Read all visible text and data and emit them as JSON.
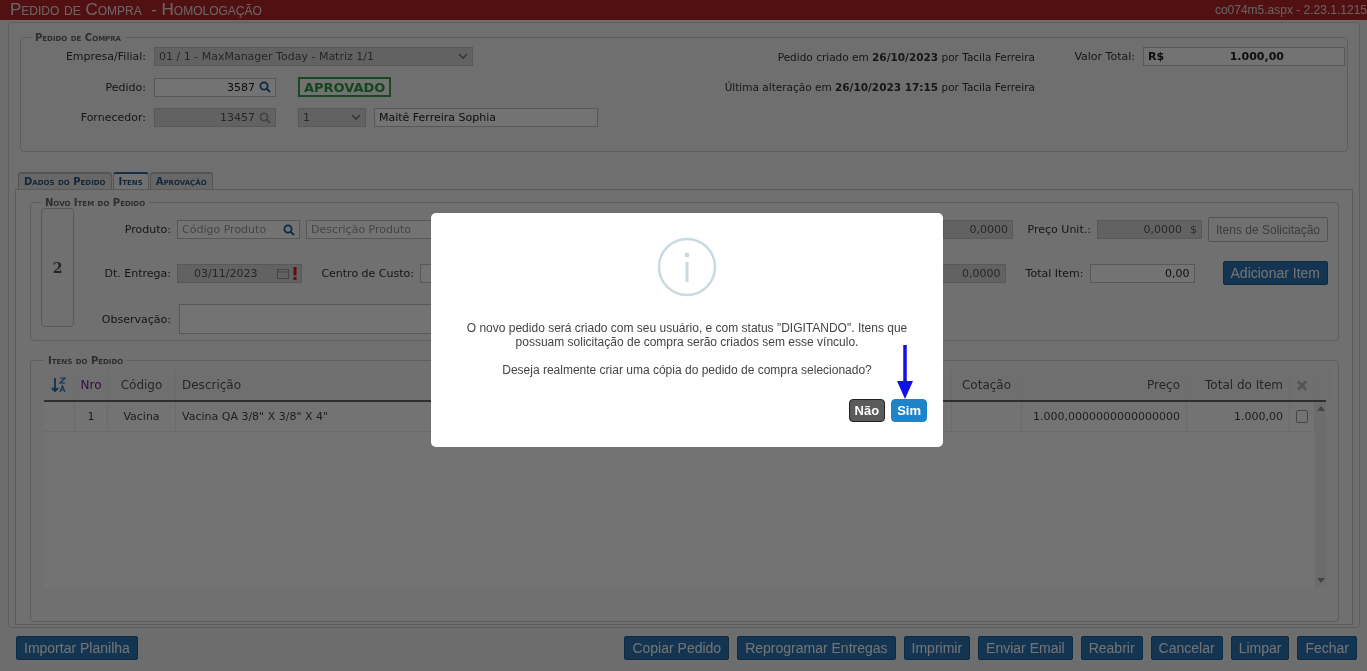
{
  "header": {
    "title": "Pedido de Compra",
    "subtitle": "- Homologação",
    "version": "co074m5.aspx - 2.23.1.1215"
  },
  "order": {
    "legend": "Pedido de Compra",
    "company": {
      "label": "Empresa/Filial:",
      "value": "01 / 1 - MaxManager Today - Matriz 1/1"
    },
    "order_number": {
      "label": "Pedido:",
      "value": "3587"
    },
    "status": "APROVADO",
    "supplier": {
      "label": "Fornecedor:",
      "code": "13457",
      "option": "1",
      "name": "Maitê Ferreira Sophia"
    },
    "created": "Pedido criado em **26/10/2023** por Tacila Ferreira",
    "modified": "Última alteração em **26/10/2023 17:15** por Tacila Ferreira",
    "total": {
      "label": "Valor Total:",
      "currency": "R$",
      "value": "1.000,00"
    }
  },
  "tabs": [
    {
      "label": "Dados do Pedido",
      "selected": false
    },
    {
      "label": "Itens",
      "selected": true
    },
    {
      "label": "Aprovação",
      "selected": false
    }
  ],
  "new_item": {
    "legend": "Novo Item do Pedido",
    "sequence": "2",
    "product": {
      "label": "Produto:",
      "code_placeholder": "Código Produto",
      "description_placeholder": "Descrição Produto"
    },
    "delivery": {
      "label": "Dt. Entrega:",
      "value": "03/11/2023",
      "warning": true
    },
    "cost_center": {
      "label": "Centro de Custo:"
    },
    "notes": {
      "label": "Observação:"
    },
    "field_1": "0,0000",
    "field_2": "0,0000",
    "unit_price": {
      "label": "Preço Unit.:",
      "value": "0,0000",
      "currency": "$"
    },
    "item_total": {
      "label": "Total Item:",
      "value": "0,00"
    },
    "buttons": [
      {
        "label": "Itens de Solicitação",
        "disabled": true
      },
      {
        "label": "Adicionar Item",
        "disabled": false
      }
    ]
  },
  "items": {
    "legend": "Itens do Pedido",
    "columns": [
      {
        "label": "Nro",
        "sorted": true
      },
      {
        "label": "Código",
        "sorted": false
      },
      {
        "label": "Descrição",
        "sorted": false
      },
      {
        "label": "Cotação",
        "sorted": false
      },
      {
        "label": "Preço",
        "sorted": false
      },
      {
        "label": "Total do Item",
        "sorted": false
      }
    ],
    "rows": [
      {
        "nro": "1",
        "code": "Vacina",
        "description": "Vacina QA 3/8\" X 3/8\" X 4\"",
        "price": "1.000,0000000000000000",
        "total": "1.000,00",
        "checked": false
      }
    ]
  },
  "footer": {
    "left": [
      {
        "label": "Importar Planilha"
      }
    ],
    "right": [
      {
        "label": "Copiar Pedido"
      },
      {
        "label": "Reprogramar Entregas"
      },
      {
        "label": "Imprimir"
      },
      {
        "label": "Enviar Email"
      },
      {
        "label": "Reabrir"
      },
      {
        "label": "Cancelar"
      },
      {
        "label": "Limpar"
      },
      {
        "label": "Fechar"
      }
    ]
  },
  "dialog": {
    "message": "O novo pedido será criado com seu usuário, e com status \"DIGITANDO\". Itens que possuam solicitação de compra serão criados sem esse vínculo.",
    "question": "Deseja realmente criar uma cópia do pedido de compra selecionado?",
    "buttons": [
      {
        "label": "Não",
        "kind": "cancel"
      },
      {
        "label": "Sim",
        "kind": "confirm"
      }
    ]
  }
}
